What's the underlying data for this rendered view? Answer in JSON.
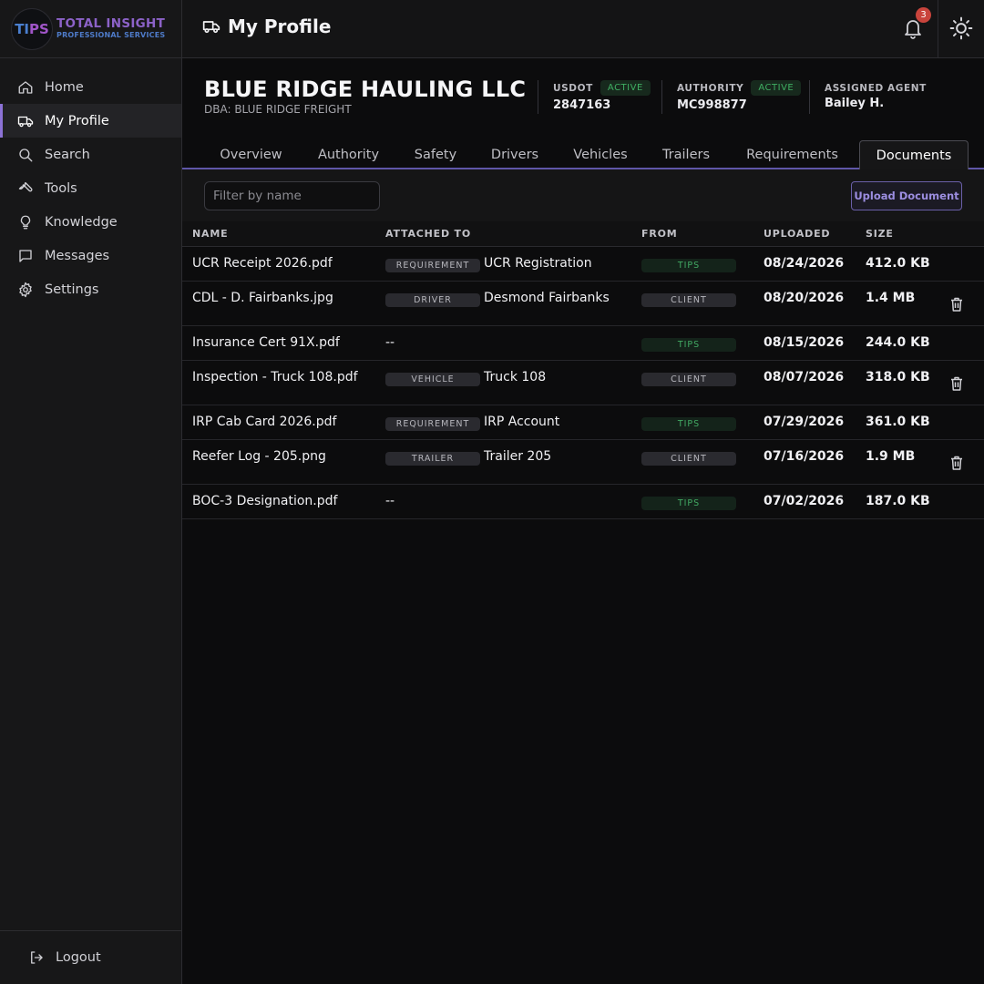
{
  "brand": {
    "badge_part1": "TI",
    "badge_part2": "PS",
    "line1": "TOTAL INSIGHT",
    "line2": "PROFESSIONAL SERVICES",
    "colors": {
      "purple": "#8c62c8",
      "blue": "#4e7bc9"
    }
  },
  "sidebar": {
    "items": [
      {
        "label": "Home",
        "icon": "home-icon"
      },
      {
        "label": "My Profile",
        "icon": "truck-icon",
        "active": true
      },
      {
        "label": "Search",
        "icon": "search-icon"
      },
      {
        "label": "Tools",
        "icon": "wrench-icon"
      },
      {
        "label": "Knowledge",
        "icon": "lightbulb-icon"
      },
      {
        "label": "Messages",
        "icon": "chat-icon"
      },
      {
        "label": "Settings",
        "icon": "gear-icon"
      }
    ],
    "logout_label": "Logout"
  },
  "header": {
    "title": "My Profile",
    "notification_count": "3"
  },
  "company": {
    "name": "BLUE RIDGE HAULING LLC",
    "dba": "DBA: BLUE RIDGE FREIGHT",
    "usdot_label": "USDOT",
    "usdot_status": "ACTIVE",
    "usdot_value": "2847163",
    "authority_label": "AUTHORITY",
    "authority_status": "ACTIVE",
    "authority_value": "MC998877",
    "agent_label": "ASSIGNED AGENT",
    "agent_value": "Bailey H."
  },
  "tabs": [
    "Overview",
    "Authority",
    "Safety",
    "Drivers",
    "Vehicles",
    "Trailers",
    "Requirements",
    "Documents"
  ],
  "active_tab": "Documents",
  "toolbar": {
    "filter_placeholder": "Filter by name",
    "upload_label": "Upload Document"
  },
  "table": {
    "headers": {
      "name": "NAME",
      "attached": "ATTACHED TO",
      "from": "FROM",
      "uploaded": "UPLOADED",
      "size": "SIZE"
    },
    "rows": [
      {
        "name": "UCR Receipt 2026.pdf",
        "tag": "REQUIREMENT",
        "attached": "UCR Registration",
        "from": "TIPS",
        "uploaded": "08/24/2026",
        "size": "412.0 KB",
        "deletable": false
      },
      {
        "name": "CDL - D. Fairbanks.jpg",
        "tag": "DRIVER",
        "attached": "Desmond Fairbanks",
        "from": "CLIENT",
        "uploaded": "08/20/2026",
        "size": "1.4 MB",
        "deletable": true
      },
      {
        "name": "Insurance Cert 91X.pdf",
        "tag": "",
        "attached": "--",
        "from": "TIPS",
        "uploaded": "08/15/2026",
        "size": "244.0 KB",
        "deletable": false
      },
      {
        "name": "Inspection - Truck 108.pdf",
        "tag": "VEHICLE",
        "attached": "Truck 108",
        "from": "CLIENT",
        "uploaded": "08/07/2026",
        "size": "318.0 KB",
        "deletable": true
      },
      {
        "name": "IRP Cab Card 2026.pdf",
        "tag": "REQUIREMENT",
        "attached": "IRP Account",
        "from": "TIPS",
        "uploaded": "07/29/2026",
        "size": "361.0 KB",
        "deletable": false
      },
      {
        "name": "Reefer Log - 205.png",
        "tag": "TRAILER",
        "attached": "Trailer 205",
        "from": "CLIENT",
        "uploaded": "07/16/2026",
        "size": "1.9 MB",
        "deletable": true
      },
      {
        "name": "BOC-3 Designation.pdf",
        "tag": "",
        "attached": "--",
        "from": "TIPS",
        "uploaded": "07/02/2026",
        "size": "187.0 KB",
        "deletable": false
      }
    ]
  },
  "colors": {
    "accent": "#8c72d6",
    "active_green": "#3fae62",
    "badge_red": "#c9443c"
  }
}
